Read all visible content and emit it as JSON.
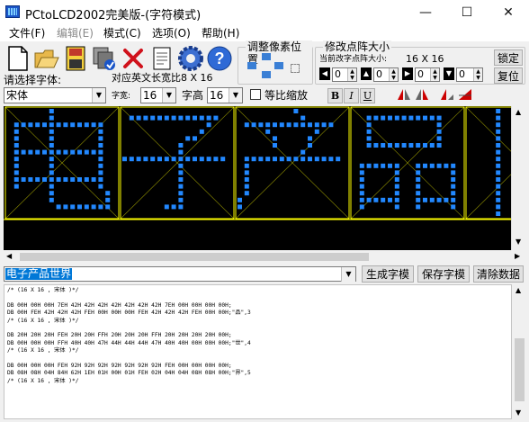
{
  "window": {
    "title": "PCtoLCD2002完美版-(字符模式)",
    "minimize": "—",
    "maximize": "☐",
    "close": "✕"
  },
  "menu": [
    {
      "label": "文件(F)",
      "enabled": true
    },
    {
      "label": "编辑(E)",
      "enabled": false
    },
    {
      "label": "模式(C)",
      "enabled": true
    },
    {
      "label": "选项(O)",
      "enabled": true
    },
    {
      "label": "帮助(H)",
      "enabled": true
    }
  ],
  "toolbar": {
    "icons": [
      "new-file-icon",
      "open-folder-icon",
      "save-icon",
      "save-all-icon",
      "delete-icon",
      "document-icon",
      "settings-icon",
      "help-icon"
    ],
    "adjust_title": "调整像素位置",
    "resize_title": "修改点阵大小",
    "current_size_label": "当前改字点阵大小:",
    "current_size_value": "16 X 16",
    "lock_button": "锁定",
    "restore_button": "复位",
    "spinners": [
      "0",
      "0",
      "0",
      "0"
    ],
    "font_label": "请选择字体:",
    "font_value": "宋体",
    "english_ratio_label": "对应英文长宽比8 X 16",
    "char_width_label": "字宽:",
    "char_width_value": "16",
    "char_height_label": "字高",
    "char_height_value": "16",
    "proportional_label": "等比缩放",
    "bold_label": "B",
    "italic_label": "I",
    "underline_label": "U"
  },
  "glyph_text": "电子产品世界",
  "buttons": {
    "generate": "生成字模",
    "save": "保存字模",
    "clear": "清除数据"
  },
  "output_lines": [
    "/* (16 X 16 , 宋体 )*/",
    "",
    "DB 00H 00H 00H 7EH 42H 42H 42H 42H 42H 42H 42H 7EH 00H 00H 00H 00H;",
    "DB 00H FEH 42H 42H 42H FEH 00H 00H 00H FEH 42H 42H 42H FEH 00H 00H;\"品\",3",
    "/* (16 X 16 , 宋体 )*/",
    "",
    "DB 20H 20H 20H FEH 20H 20H FFH 20H 20H 20H FFH 20H 20H 20H 20H 00H;",
    "DB 00H 00H 00H FFH 40H 40H 47H 44H 44H 44H 47H 40H 40H 00H 00H 00H;\"世\",4",
    "/* (16 X 16 , 宋体 )*/",
    "",
    "DB 00H 00H 00H FEH 92H 92H 92H 92H 92H 92H 92H FEH 00H 00H 00H 00H;",
    "DB 08H 08H 04H 84H 62H 1EH 01H 00H 01H FEH 02H 04H 04H 08H 08H 00H;\"界\",5",
    "/* (16 X 16 , 宋体 )*/"
  ],
  "colors": {
    "pixel": "#2288ff",
    "grid": "#ffff00",
    "canvas": "#000000",
    "selection": "#0078d7"
  },
  "glyph_bitmaps": [
    [
      "0000001000000000",
      "0000001000000000",
      "0111111111111100",
      "0100001000000100",
      "0100001000000100",
      "0100001000000100",
      "0111111111111100",
      "0100001000000100",
      "0100001000000100",
      "0100001000000100",
      "0111111111111100",
      "0100001000000100",
      "0000001000000010",
      "0000001000000010",
      "0000000111111110",
      "0000000000000000"
    ],
    [
      "0000000000000000",
      "0111111111111100",
      "0000000000001000",
      "0000000000010000",
      "0000000001100000",
      "0000000010000000",
      "0000000010000000",
      "1111111111111110",
      "0000000010000000",
      "0000000010000000",
      "0000000010000000",
      "0000000010000000",
      "0000000010000000",
      "0000000010000000",
      "0000001110000000",
      "0000000000000000"
    ],
    [
      "0000000010000000",
      "0000000001000000",
      "0111111111111100",
      "0000100000010000",
      "0000010000100000",
      "0000010000100000",
      "0000000001000000",
      "0111111111111110",
      "0100000000000000",
      "0100000000000000",
      "0100000000000000",
      "0100000000000000",
      "0100000000000000",
      "1000000000000000",
      "1000000000000000",
      "0000000000000000"
    ],
    [
      "0000000000000000",
      "0011111111111000",
      "0010000000001000",
      "0010000000001000",
      "0010000000001000",
      "0011111111111000",
      "0000000000000000",
      "0000000000000000",
      "0111111001111110",
      "0100001001000010",
      "0100001001000010",
      "0100001001000010",
      "0100001001000010",
      "0111111001111110",
      "0100001001000010",
      "0000000000000000"
    ],
    [
      "0000100010000000",
      "0000100010000000",
      "0000100010000000",
      "0000100010000000",
      "0000100010000000",
      "0000100010000000",
      "0000100010000000",
      "0000100010000000",
      "0000100010000000",
      "0000100010000000",
      "0000100010000000",
      "0000100010000000",
      "0000100010000000",
      "0000100010000000",
      "0000100010000000",
      "0000100010000000"
    ]
  ]
}
